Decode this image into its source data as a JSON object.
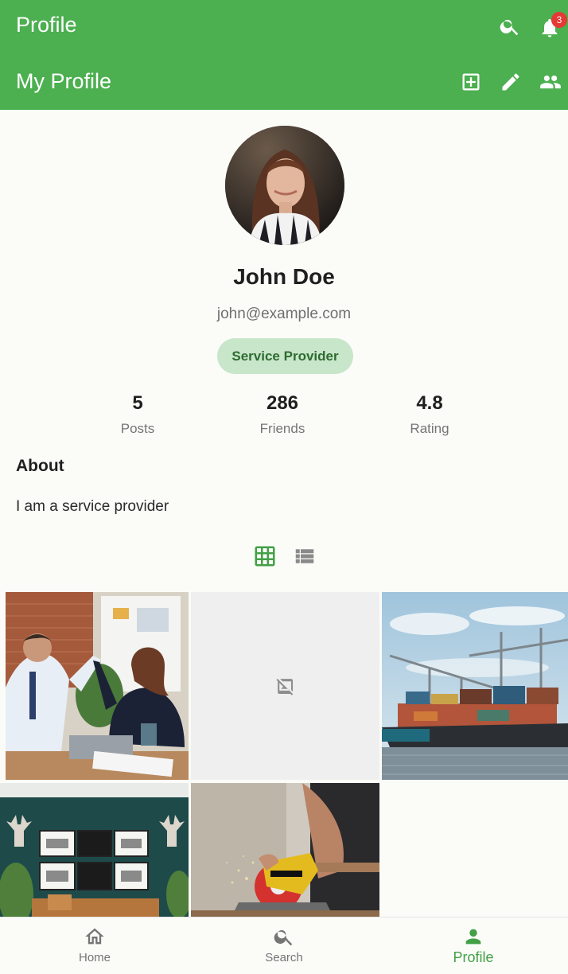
{
  "appbar": {
    "title": "Profile",
    "subtitle": "My Profile",
    "notification_count": "3",
    "icons": [
      "search-icon",
      "notifications-icon",
      "add-box-icon",
      "edit-icon",
      "people-icon"
    ]
  },
  "profile": {
    "name": "John Doe",
    "email": "john@example.com",
    "role": "Service Provider"
  },
  "stats": [
    {
      "value": "5",
      "label": "Posts"
    },
    {
      "value": "286",
      "label": "Friends"
    },
    {
      "value": "4.8",
      "label": "Rating"
    }
  ],
  "about": {
    "title": "About",
    "text": "I am a service provider"
  },
  "view_toggle": {
    "selected": "grid",
    "options": [
      "grid-view-icon",
      "list-view-icon"
    ]
  },
  "posts": [
    {
      "image": "office-high-five-photo"
    },
    {
      "image": "broken-image-placeholder"
    },
    {
      "image": "cargo-ship-port-photo"
    },
    {
      "image": "living-room-wall-art-photo"
    },
    {
      "image": "circular-saw-woodwork-photo"
    }
  ],
  "bottom_nav": {
    "items": [
      {
        "label": "Home",
        "icon": "home-icon"
      },
      {
        "label": "Search",
        "icon": "search-icon"
      },
      {
        "label": "Profile",
        "icon": "person-icon"
      }
    ],
    "active": "Profile"
  },
  "colors": {
    "primary": "#4caf50",
    "chip_bg": "#c8e6c9",
    "badge": "#e53935",
    "background": "#fbfcf8"
  }
}
